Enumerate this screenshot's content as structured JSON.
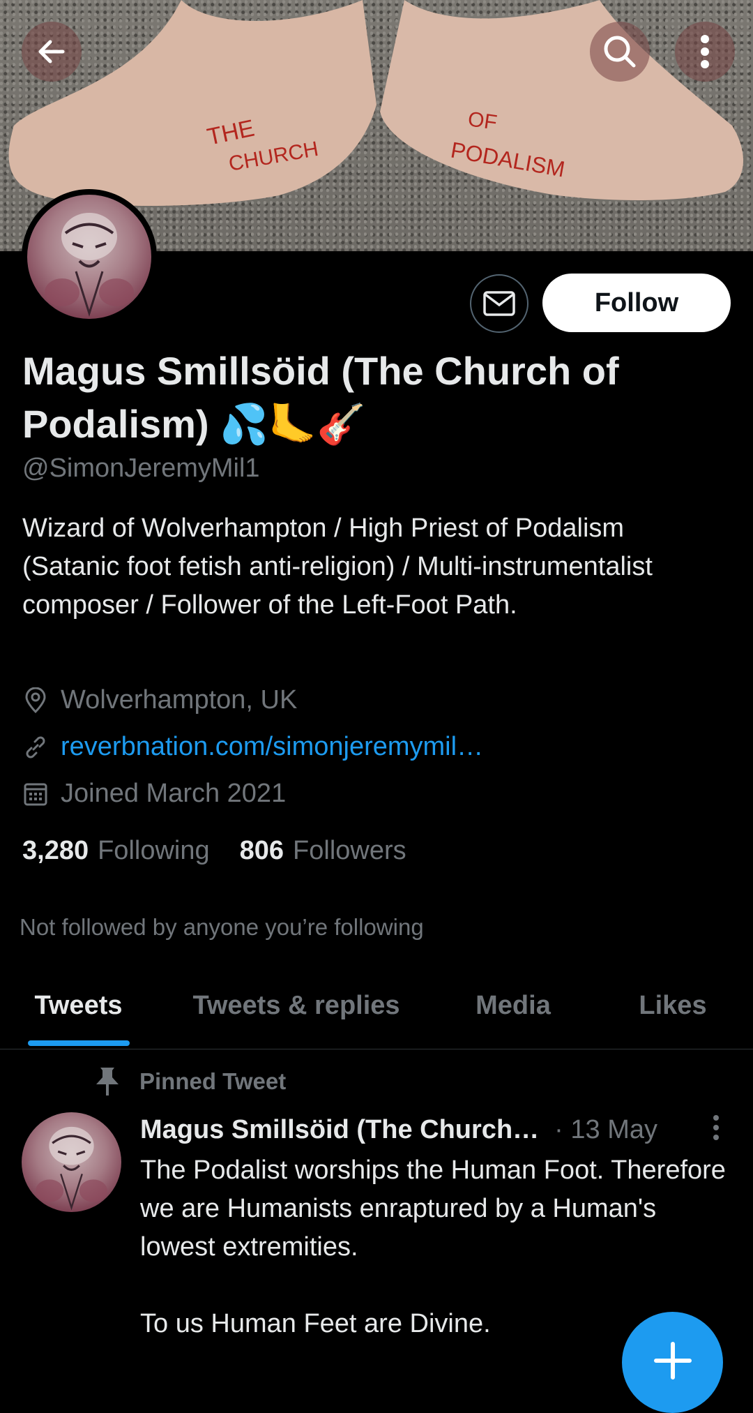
{
  "banner": {
    "left_foot_text": [
      "THE",
      "CHURCH"
    ],
    "right_foot_text": [
      "OF",
      "PODALISM"
    ]
  },
  "profile": {
    "display_name": "Magus Smillsöid (The Church of Podalism) 💦🦶🎸",
    "handle": "@SimonJeremyMil1",
    "bio": "Wizard of Wolverhampton / High Priest of Podalism (Satanic foot fetish anti-religion) / Multi-instrumentalist composer / Follower of the Left-Foot Path.",
    "location": "Wolverhampton, UK",
    "website": "reverbnation.com/simonjeremymil…",
    "joined": "Joined March 2021",
    "following_count": "3,280",
    "following_label": "Following",
    "followers_count": "806",
    "followers_label": "Followers",
    "not_followed_text": "Not followed by anyone you’re following",
    "follow_label": "Follow"
  },
  "tabs": [
    {
      "label": "Tweets",
      "active": true
    },
    {
      "label": "Tweets & replies",
      "active": false
    },
    {
      "label": "Media",
      "active": false
    },
    {
      "label": "Likes",
      "active": false
    }
  ],
  "pinned_tweet": {
    "pinned_label": "Pinned Tweet",
    "author": "Magus Smillsöid (The Church…",
    "date": "· 13 May",
    "paragraphs": [
      "The Podalist worships the Human Foot. Therefore we are Humanists enraptured by a Human's lowest extremities.",
      "To us Human Feet are Divine."
    ]
  },
  "colors": {
    "accent": "#1d9bf0",
    "background": "#000000",
    "text_primary": "#e7e9ea",
    "text_secondary": "#71767b"
  },
  "icons": {
    "back": "arrow-left-icon",
    "search": "search-icon",
    "more": "more-vertical-icon",
    "message": "envelope-icon",
    "location": "location-pin-icon",
    "link": "link-icon",
    "calendar": "calendar-icon",
    "pin": "pin-icon",
    "compose": "plus-icon"
  }
}
